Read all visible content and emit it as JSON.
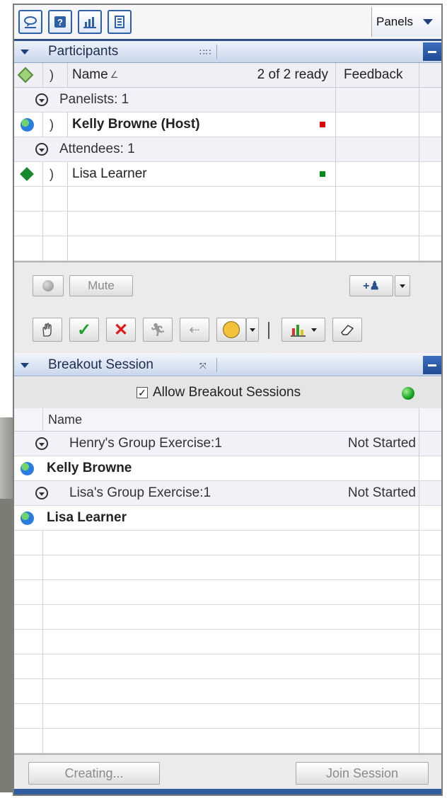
{
  "toolbar": {
    "icons": [
      "chat-bubble-icon",
      "help-icon",
      "poll-chart-icon",
      "notes-list-icon"
    ],
    "panels_label": "Panels"
  },
  "participants": {
    "title": "Participants",
    "header": {
      "name": "Name",
      "ready": "2 of 2 ready",
      "feedback": "Feedback"
    },
    "groups": [
      {
        "label": "Panelists: 1",
        "members": [
          {
            "name": "Kelly Browne (Host)",
            "status": "red"
          }
        ]
      },
      {
        "label": "Attendees: 1",
        "members": [
          {
            "name": "Lisa Learner",
            "status": "green"
          }
        ]
      }
    ],
    "mute_label": "Mute"
  },
  "breakout": {
    "title": "Breakout Session",
    "allow_label": "Allow Breakout Sessions",
    "allow_checked": true,
    "column_name": "Name",
    "groups": [
      {
        "label": "Henry's Group Exercise:1",
        "status": "Not Started",
        "member": "Kelly Browne"
      },
      {
        "label": "Lisa's Group Exercise:1",
        "status": "Not Started",
        "member": "Lisa Learner"
      }
    ],
    "creating_label": "Creating...",
    "join_label": "Join Session"
  },
  "colors": {
    "accent": "#2f4f8a",
    "ready_green": "#16a020",
    "host_red": "#e00000"
  }
}
